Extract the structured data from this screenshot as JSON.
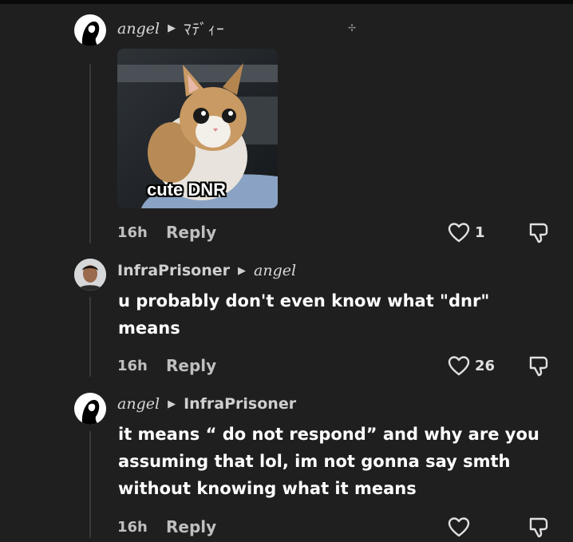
{
  "comments": [
    {
      "author": "angel",
      "reply_to": "ﾏﾃﾞｨｰ",
      "sticker_caption": "cute DNR",
      "time": "16h",
      "reply_label": "Reply",
      "likes": "1"
    },
    {
      "author": "InfraPrisoner",
      "reply_to": "angel",
      "text_line1": "u probably don't even know what \"dnr\"",
      "text_line2": "means",
      "time": "16h",
      "reply_label": "Reply",
      "likes": "26"
    },
    {
      "author": "angel",
      "reply_to": "InfraPrisoner",
      "text_line1": "it means “ do not respond” and why are you",
      "text_line2": "assuming that lol, im not gonna say smth",
      "text_line3": "without knowing what it means",
      "time": "16h",
      "reply_label": "Reply",
      "likes": ""
    }
  ],
  "icons": {
    "like": "heart-outline-icon",
    "dislike": "thumbs-down-icon",
    "reply_arrow": "right-triangle-icon",
    "sparkle": "sparkle-icon"
  },
  "colors": {
    "background": "#1f1f1f",
    "text": "#ffffff",
    "muted": "#bfbfbf"
  }
}
